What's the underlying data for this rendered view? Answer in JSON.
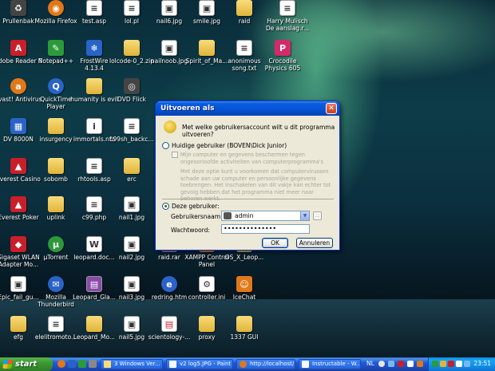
{
  "desktop": {
    "icons": [
      {
        "label": "Prullenbak",
        "icon": "recycle-bin-icon"
      },
      {
        "label": "Mozilla Firefox",
        "icon": "firefox-icon"
      },
      {
        "label": "test.asp",
        "icon": "file-icon"
      },
      {
        "label": "lol.pl",
        "icon": "file-icon"
      },
      {
        "label": "nail6.jpg",
        "icon": "image-file-icon"
      },
      {
        "label": "smile.jpg",
        "icon": "image-file-icon"
      },
      {
        "label": "raid",
        "icon": "folder-icon"
      },
      {
        "label": "Harry Mulisch De aanslag.r...",
        "icon": "document-icon"
      },
      {
        "label": "Adobe Reader 8",
        "icon": "adobe-reader-icon"
      },
      {
        "label": "Notepad++",
        "icon": "notepad-icon"
      },
      {
        "label": "FrostWire 4.13.4",
        "icon": "frostwire-icon"
      },
      {
        "label": "lolcode-0_2.zip",
        "icon": "zip-folder-icon"
      },
      {
        "label": "nailnoob.jpg",
        "icon": "image-file-icon"
      },
      {
        "label": "Spirit_of_Ma...",
        "icon": "folder-icon"
      },
      {
        "label": "anonimous song.txt",
        "icon": "text-file-icon"
      },
      {
        "label": "Crocodile Physics 605",
        "icon": "crocodile-physics-icon"
      },
      {
        "label": "avast! Antivirus",
        "icon": "avast-icon"
      },
      {
        "label": "QuickTime Player",
        "icon": "quicktime-icon"
      },
      {
        "label": "humanity is evil",
        "icon": "folder-icon"
      },
      {
        "label": "DVD Flick",
        "icon": "dvd-flick-icon"
      },
      {
        "label": "DV 8000N",
        "icon": "dv-8000n-icon"
      },
      {
        "label": "insurgency",
        "icon": "folder-icon"
      },
      {
        "label": "immortals.nfo",
        "icon": "nfo-file-icon"
      },
      {
        "label": "c99sh_backc...",
        "icon": "file-icon"
      },
      {
        "label": "Everest Casino",
        "icon": "everest-casino-icon"
      },
      {
        "label": "sobomb",
        "icon": "folder-icon"
      },
      {
        "label": "rhtools.asp",
        "icon": "file-icon"
      },
      {
        "label": "erc",
        "icon": "folder-icon"
      },
      {
        "label": "Everest Poker",
        "icon": "everest-poker-icon"
      },
      {
        "label": "uplink",
        "icon": "folder-icon"
      },
      {
        "label": "c99.php",
        "icon": "php-file-icon"
      },
      {
        "label": "nail1.jpg",
        "icon": "image-file-icon"
      },
      {
        "label": "Gigaset WLAN Adapter Mo...",
        "icon": "gigaset-icon"
      },
      {
        "label": "µTorrent",
        "icon": "utorrent-icon"
      },
      {
        "label": "leopard.doc...",
        "icon": "word-document-icon"
      },
      {
        "label": "nail2.jpg",
        "icon": "image-file-icon"
      },
      {
        "label": "raid.rar",
        "icon": "rar-archive-icon"
      },
      {
        "label": "XAMPP Control Panel",
        "icon": "xampp-icon"
      },
      {
        "label": "OS_X_Leop...",
        "icon": "folder-icon"
      },
      {
        "label": "Epic_fail_gu...",
        "icon": "image-file-icon"
      },
      {
        "label": "Mozilla Thunderbird",
        "icon": "thunderbird-icon"
      },
      {
        "label": "Leopard_Gla...",
        "icon": "archive-icon"
      },
      {
        "label": "nail3.jpg",
        "icon": "image-file-icon"
      },
      {
        "label": "redring.htm",
        "icon": "html-file-icon"
      },
      {
        "label": "controller.ini",
        "icon": "settings-file-icon"
      },
      {
        "label": "IceChat",
        "icon": "icechat-icon"
      },
      {
        "label": "efg",
        "icon": "folder-icon"
      },
      {
        "label": "elelitromoto...",
        "icon": "file-icon"
      },
      {
        "label": "Leopard_Mo...",
        "icon": "folder-icon"
      },
      {
        "label": "nail5.jpg",
        "icon": "image-file-icon"
      },
      {
        "label": "scientology-...",
        "icon": "pdf-file-icon"
      },
      {
        "label": "proxy",
        "icon": "folder-icon"
      },
      {
        "label": "1337 GUI",
        "icon": "folder-icon"
      }
    ]
  },
  "dialog": {
    "title": "Uitvoeren als",
    "question": "Met welke gebruikersaccount wilt u dit programma uitvoeren?",
    "current_user_label": "Huidige gebruiker (BOVEN\\Dick Junior)",
    "protect_label": "Mijn computer en gegevens beschermen tegen ongeoorloofde activiteiten van computerprogramma's",
    "protect_info": "Met deze optie kunt u voorkomen dat computervirussen schade aan uw computer en persoonlijke gegevens toebrengen. Het inschakelen van dit vakje kan echter tot gevolg hebben dat het programma niet meer naar behoren werkt.",
    "other_user_label": "Deze gebruiker:",
    "username_label": "Gebruikersnaam:",
    "username_value": "admin",
    "password_label": "Wachtwoord:",
    "password_value": "••••••••••••••",
    "ok_label": "OK",
    "cancel_label": "Annuleren"
  },
  "taskbar": {
    "start_label": "start",
    "tasks": [
      {
        "label": "3 Windows Ver..."
      },
      {
        "label": "v2 log5.JPG - Paint"
      },
      {
        "label": "http://localhost/..."
      },
      {
        "label": "Instructable - W..."
      }
    ],
    "language": "NL",
    "clock": "23:51"
  },
  "colors": {
    "titlebar": "#0552d4",
    "dialog_bg": "#ece9d8",
    "taskbar": "#2157d7",
    "start_button": "#3c9a34"
  }
}
